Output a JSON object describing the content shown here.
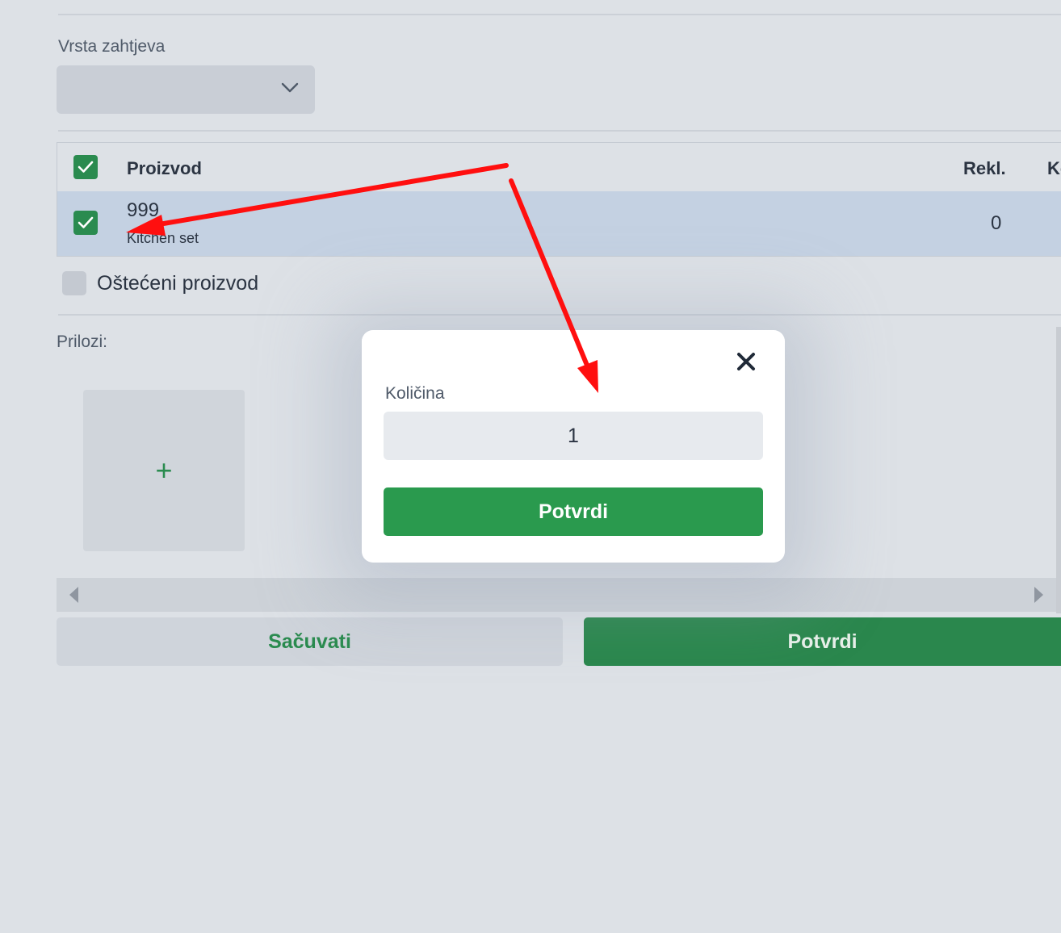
{
  "form": {
    "request_type_label": "Vrsta zahtjeva",
    "request_type_value": ""
  },
  "table": {
    "headers": {
      "product": "Proizvod",
      "rekl": "Rekl.",
      "next_partial": "Ko"
    },
    "rows": [
      {
        "checked": true,
        "code": "999",
        "name": "Kitchen set",
        "rekl": "0"
      }
    ]
  },
  "damaged": {
    "label": "Oštećeni proizvod",
    "checked": false
  },
  "attachments": {
    "label": "Prilozi:",
    "add_symbol": "+"
  },
  "actions": {
    "save_label": "Sačuvati",
    "confirm_label": "Potvrdi"
  },
  "modal": {
    "quantity_label": "Količina",
    "quantity_value": "1",
    "confirm_label": "Potvrdi"
  },
  "icons": {
    "close": "close-icon",
    "check": "check-icon",
    "chevron": "chevron-down-icon"
  },
  "colors": {
    "accent_green": "#2a9a4e",
    "annotation_red": "#ff0000",
    "row_highlight": "#c4d1e2"
  }
}
